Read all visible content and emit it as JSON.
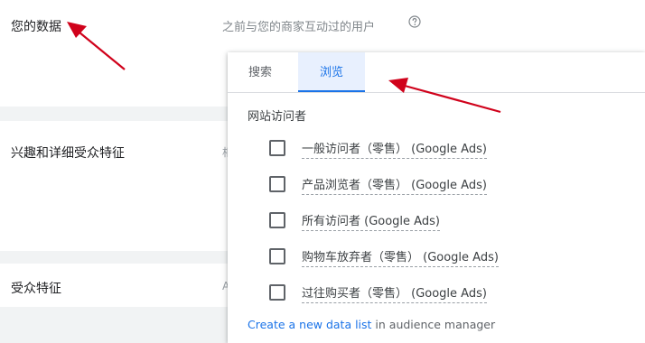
{
  "rows": {
    "your_data": "您的数据",
    "interests": "兴趣和详细受众特征",
    "demographics": "受众特征",
    "clip_char_row2": "相",
    "clip_char_row3": "A"
  },
  "your_data_desc": "之前与您的商家互动过的用户",
  "icons": {
    "help": "help-circle-icon",
    "checkbox": "checkbox-empty-icon",
    "arrow": "red-arrow-annotation"
  },
  "dropdown": {
    "tabs": [
      {
        "label": "搜索",
        "active": false
      },
      {
        "label": "浏览",
        "active": true
      }
    ],
    "section_label": "网站访问者",
    "options": [
      {
        "label": "一般访问者（零售） (Google Ads)",
        "checked": false
      },
      {
        "label": "产品浏览者（零售） (Google Ads)",
        "checked": false
      },
      {
        "label": "所有访问者 (Google Ads)",
        "checked": false
      },
      {
        "label": "购物车放弃者（零售） (Google Ads)",
        "checked": false
      },
      {
        "label": "过往购买者（零售） (Google Ads)",
        "checked": false
      }
    ],
    "footer": {
      "link_text": "Create a new data list",
      "suffix": " in audience manager"
    }
  },
  "colors": {
    "accent": "#1a73e8",
    "active_tab_bg": "#e8f0fe",
    "annotation": "#d0021b"
  }
}
